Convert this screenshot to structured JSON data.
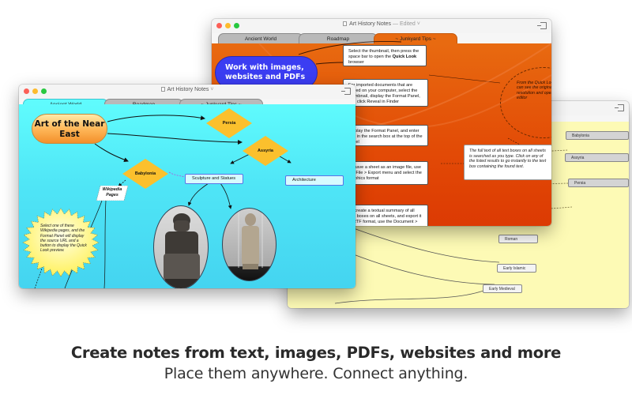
{
  "windows": {
    "orange": {
      "title": "Art History Notes",
      "edited_label": "— Edited ˅",
      "tabs": [
        "Ancient World",
        "Roadmap",
        "~ Junkyard Tips ~"
      ],
      "active_tab": 2,
      "background_color": "#e24a06",
      "main_node": "Work with images, websites and PDFs",
      "notes": [
        {
          "html_prefix": "Select the thumbnail, then press the space bar to open the ",
          "bold": "Quick Look",
          "suffix": " browser"
        },
        {
          "text": "For imported documents that are stored on your computer, select the thumbnail, display the Format Panel, and click Reveal in Finder"
        },
        {
          "text": "Display the Format Panel, and enter text in the search box at the top of the panel"
        },
        {
          "text": "To save a sheet as an image file, use the File > Export menu and select the graphics format"
        },
        {
          "text": "To create a textual summary of all text boxes on all sheets, and export it in RTF format, use the Document >"
        }
      ],
      "ellipse_note": "From the Quick Look browser, you can see the original document in full resolution and open it in its native editor",
      "search_note": "The full text of all text boxes on all sheets is searched as you type. Click on any of the listed results to go instantly to the text box containing the found text."
    },
    "yellow": {
      "background_color": "#fdfab5",
      "nodes": [
        "Babylonia",
        "Assyria",
        "Persia",
        "Roman",
        "Early Islamic",
        "Early Medieval"
      ]
    },
    "cyan": {
      "title": "Art History Notes",
      "title_suffix": "˅",
      "tabs": [
        "Ancient World",
        "Roadmap",
        "~ Junkyard Tips ~"
      ],
      "active_tab": 0,
      "background_color": "#4fe5f6",
      "main_node": "Art of the Near East",
      "diamonds": [
        "Persia",
        "Assyria",
        "Babylonia"
      ],
      "boxes": [
        "Sculpture and Statues",
        "Architecture"
      ],
      "wiki_node": "Wikipedia Pages",
      "star_note": "Select one of these Wikipedia pages, and the Format Panel will display the source URL and a button to display the Quick Look preview.",
      "photos": [
        "statue-seated-gudea",
        "statue-standing-figure"
      ]
    }
  },
  "caption": {
    "headline": "Create notes from text, images, PDFs, websites and more",
    "subline": "Place them anywhere. Connect anything."
  }
}
